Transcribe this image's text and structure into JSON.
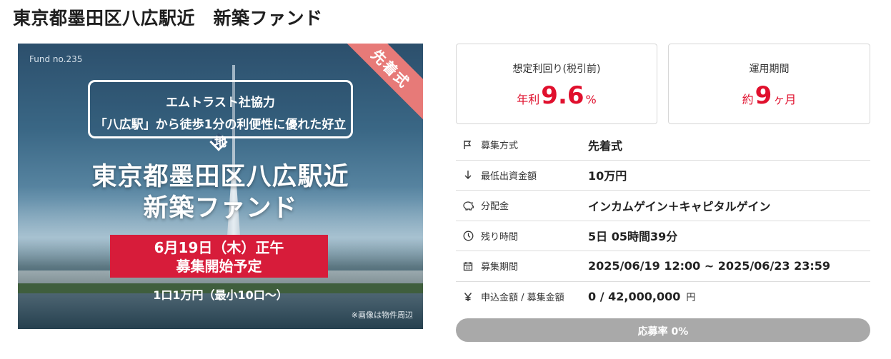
{
  "page": {
    "title": "東京都墨田区八広駅近　新築ファンド"
  },
  "hero": {
    "fund_number": "Fund no.235",
    "ribbon": "先着式",
    "callout_line1": "エムトラスト社協力",
    "callout_line2": "「八広駅」から徒歩1分の利便性に優れた好立地",
    "title_line1": "東京都墨田区八広駅近",
    "title_line2": "新築ファンド",
    "banner_line1": "6月19日（木）正午",
    "banner_line2": "募集開始予定",
    "unit_text": "1口1万円（最小10口〜）",
    "image_note": "※画像は物件周辺"
  },
  "stats": {
    "yield": {
      "label": "想定利回り(税引前)",
      "prefix": "年利",
      "value": "9.6",
      "suffix": "%"
    },
    "period": {
      "label": "運用期間",
      "prefix": "約",
      "value": "9",
      "suffix": "ヶ月"
    },
    "accent_color": "#e0102d"
  },
  "details": [
    {
      "icon": "flag-icon",
      "label": "募集方式",
      "value": "先着式",
      "unit": ""
    },
    {
      "icon": "arrow-down-icon",
      "label": "最低出資金額",
      "value": "10万円",
      "unit": ""
    },
    {
      "icon": "piggy-bank-icon",
      "label": "分配金",
      "value": "インカムゲイン＋キャピタルゲイン",
      "unit": ""
    },
    {
      "icon": "clock-icon",
      "label": "残り時間",
      "value": "5日 05時間39分",
      "unit": ""
    },
    {
      "icon": "calendar-icon",
      "label": "募集期間",
      "value": "2025/06/19 12:00 ~ 2025/06/23 23:59",
      "unit": ""
    },
    {
      "icon": "yen-icon",
      "label": "申込金額 / 募集金額",
      "value": "0 / 42,000,000",
      "unit": "円"
    }
  ],
  "progress": {
    "label": "応募率 0%",
    "fraction": 0,
    "fill_color": "#d71c3a",
    "track_color": "#a9a9a9"
  }
}
